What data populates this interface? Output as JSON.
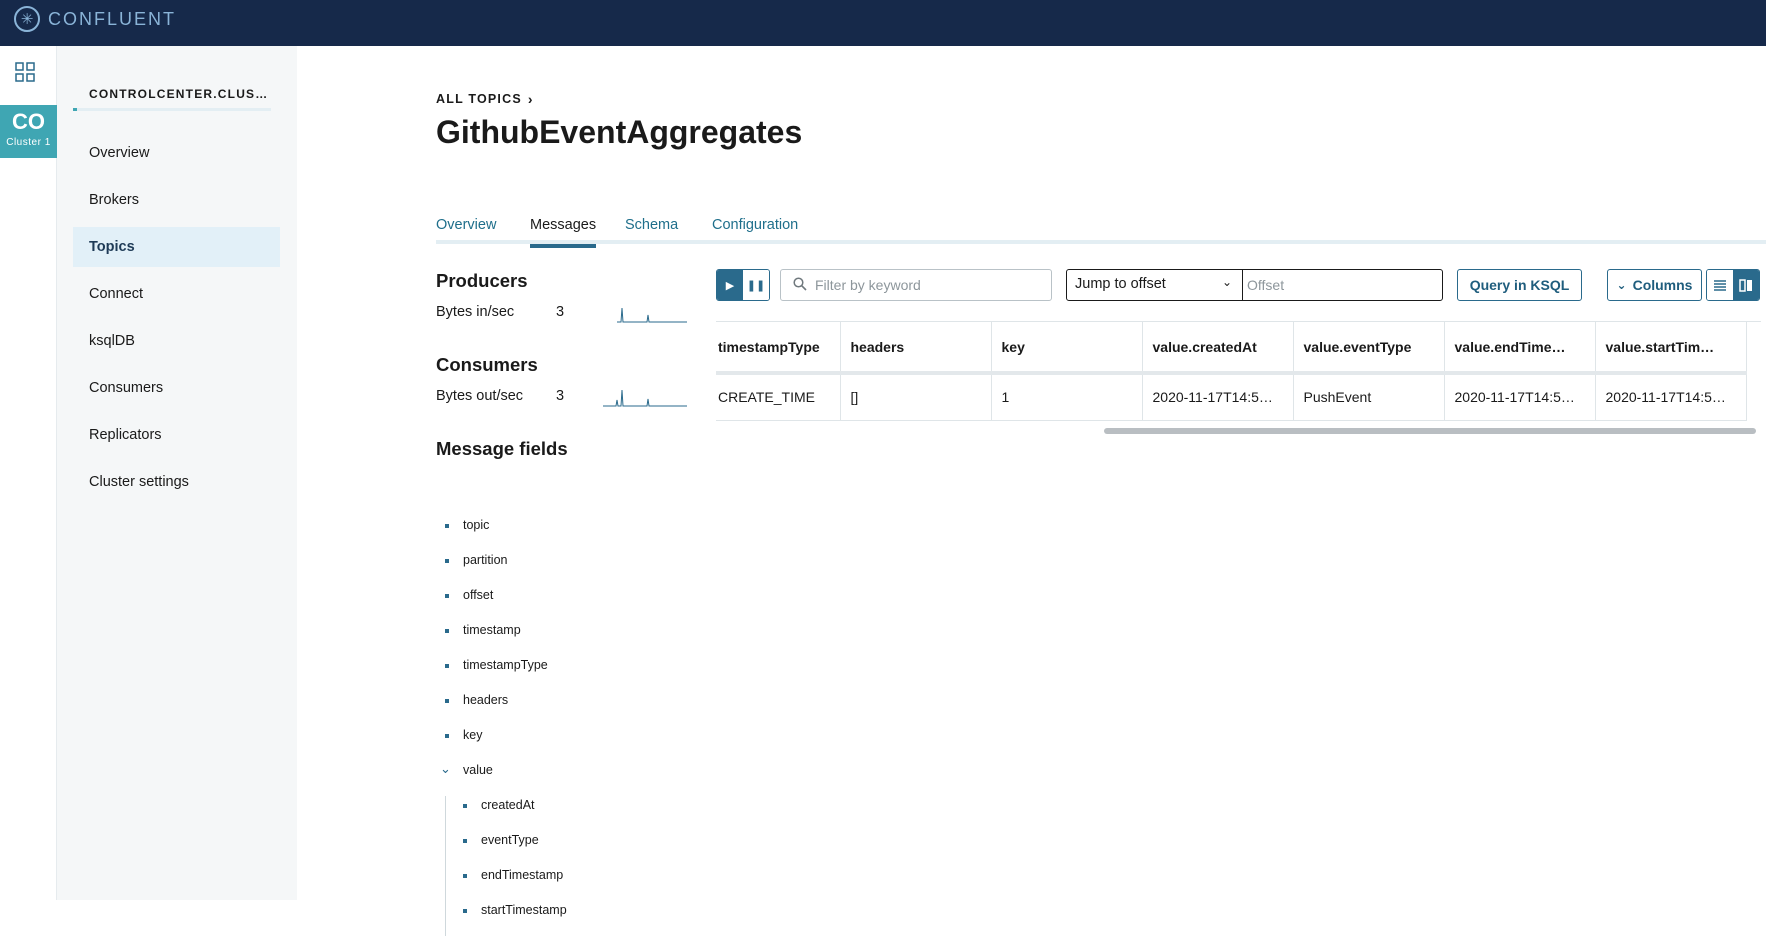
{
  "brand": {
    "name": "CONFLUENT"
  },
  "rail": {
    "cluster_abbr": "CO",
    "cluster_name": "Cluster 1"
  },
  "sidebar": {
    "title": "CONTROLCENTER.CLUS…",
    "items": [
      {
        "label": "Overview"
      },
      {
        "label": "Brokers"
      },
      {
        "label": "Topics",
        "active": true
      },
      {
        "label": "Connect"
      },
      {
        "label": "ksqlDB"
      },
      {
        "label": "Consumers"
      },
      {
        "label": "Replicators"
      },
      {
        "label": "Cluster settings"
      }
    ]
  },
  "breadcrumb": {
    "label": "ALL TOPICS"
  },
  "page": {
    "title": "GithubEventAggregates"
  },
  "tabs": [
    {
      "label": "Overview"
    },
    {
      "label": "Messages",
      "active": true
    },
    {
      "label": "Schema"
    },
    {
      "label": "Configuration"
    }
  ],
  "producers": {
    "heading": "Producers",
    "metric_label": "Bytes in/sec",
    "metric_value": "3"
  },
  "consumers": {
    "heading": "Consumers",
    "metric_label": "Bytes out/sec",
    "metric_value": "3"
  },
  "message_fields": {
    "heading": "Message fields",
    "fields": [
      "topic",
      "partition",
      "offset",
      "timestamp",
      "timestampType",
      "headers",
      "key"
    ],
    "expandable": {
      "label": "value",
      "children": [
        "createdAt",
        "eventType",
        "endTimestamp",
        "startTimestamp"
      ]
    }
  },
  "toolbar": {
    "filter_placeholder": "Filter by keyword",
    "jump_label": "Jump to offset",
    "offset_placeholder": "Offset",
    "query_label": "Query in KSQL",
    "columns_label": "Columns"
  },
  "table": {
    "columns": [
      "timestampType",
      "headers",
      "key",
      "value.createdAt",
      "value.eventType",
      "value.endTime…",
      "value.startTim…"
    ],
    "rows": [
      [
        "CREATE_TIME",
        "[]",
        "1",
        "2020-11-17T14:5…",
        "PushEvent",
        "2020-11-17T14:5…",
        "2020-11-17T14:5…"
      ]
    ]
  },
  "colors": {
    "topbar": "#16294a",
    "accent": "#2a6a8c",
    "cluster_badge": "#3fa6b3",
    "sidebar_bg": "#f5f7f8"
  },
  "icons": {
    "logo": "confluent-logo-icon",
    "apps": "grid-icon",
    "breadcrumb": "chevron-right-icon",
    "play": "play-icon",
    "pause": "pause-icon",
    "search": "search-icon",
    "dropdown": "chevron-down-icon",
    "list_view": "list-view-icon",
    "card_view": "card-view-icon"
  }
}
